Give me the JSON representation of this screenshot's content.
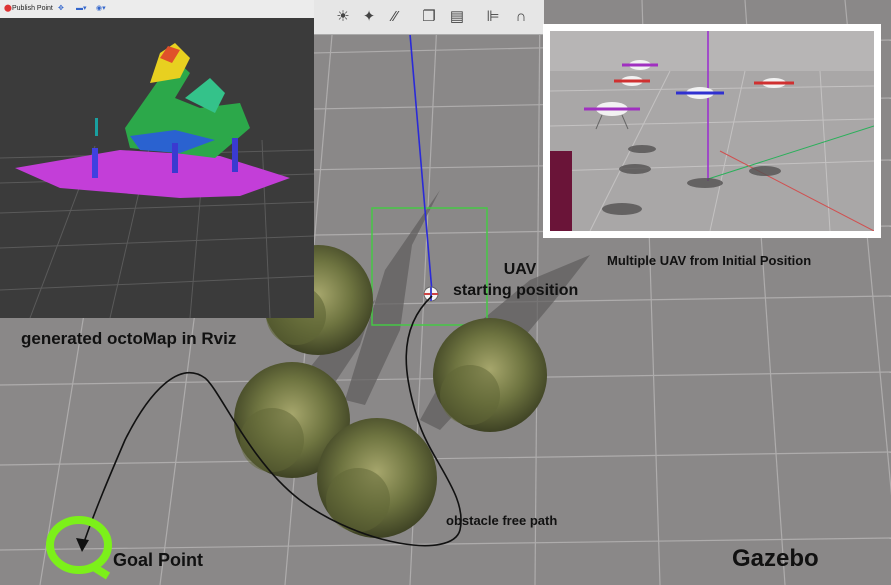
{
  "rviz": {
    "publish_point_label": "Publish Point",
    "caption": "generated octoMap in Rviz"
  },
  "gazebo": {
    "toolbar_icons": [
      "sun-light-icon",
      "point-light-icon",
      "directional-light-icon",
      "copy-icon",
      "paste-icon",
      "align-icon",
      "snap-magnet-icon"
    ],
    "brand": "Gazebo",
    "uav_label_line1": "UAV",
    "uav_label_line2": "starting position",
    "multi_uav_label": "Multiple UAV from Initial Position",
    "path_label": "obstacle free path",
    "goal_label": "Goal Point"
  },
  "colors": {
    "ground": "#8a8888",
    "grid": "#b4b2b2",
    "octomap_floor": "#c33ed8",
    "path": "#111111",
    "goal_ring": "#7cf01a",
    "selection_box": "#46c846",
    "uav_ray": "#2a2ad8",
    "tree": "#6e7440"
  }
}
